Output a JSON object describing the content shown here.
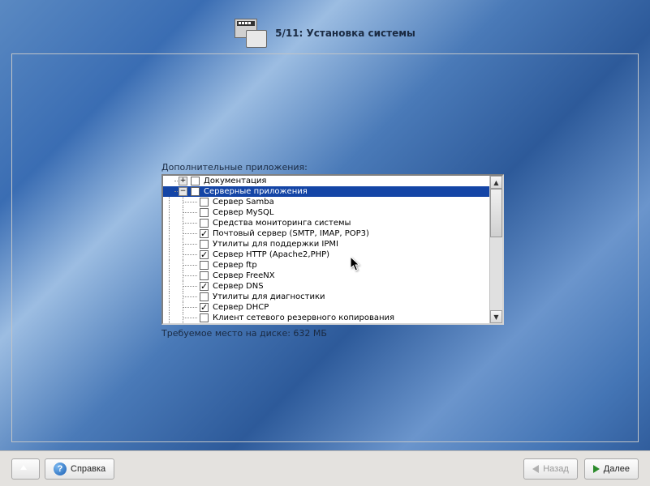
{
  "header": {
    "step": "5/11: Установка системы"
  },
  "labels": {
    "additional_apps": "Дополнительные приложения:",
    "disk_required": "Требуемое место на диске: 632 МБ"
  },
  "tree": {
    "root": {
      "label": "Документация",
      "expandable": true,
      "open": false,
      "checked": false
    },
    "group": {
      "label": "Серверные приложения",
      "expandable": true,
      "open": true,
      "checked": false,
      "selected": true
    },
    "items": [
      {
        "label": "Сервер Samba",
        "checked": false
      },
      {
        "label": "Сервер MySQL",
        "checked": false
      },
      {
        "label": "Средства мониторинга системы",
        "checked": false
      },
      {
        "label": "Почтовый сервер (SMTP, IMAP, POP3)",
        "checked": true
      },
      {
        "label": "Утилиты для поддержки IPMI",
        "checked": false
      },
      {
        "label": "Сервер HTTP (Apache2,PHP)",
        "checked": true
      },
      {
        "label": "Сервер ftp",
        "checked": false
      },
      {
        "label": "Сервер FreeNX",
        "checked": false
      },
      {
        "label": "Сервер DNS",
        "checked": true
      },
      {
        "label": "Утилиты для диагностики",
        "checked": false
      },
      {
        "label": "Сервер DHCP",
        "checked": true
      },
      {
        "label": "Клиент сетевого резервного копирования",
        "checked": false
      }
    ]
  },
  "buttons": {
    "help": "Справка",
    "back": "Назад",
    "next": "Далее"
  }
}
